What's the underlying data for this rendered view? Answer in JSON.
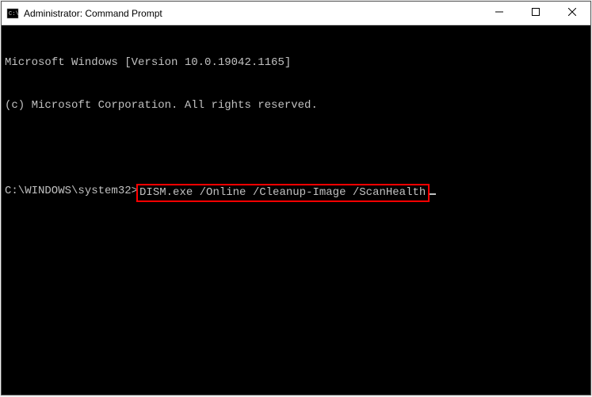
{
  "window": {
    "title": "Administrator: Command Prompt"
  },
  "terminal": {
    "header_line1": "Microsoft Windows [Version 10.0.19042.1165]",
    "header_line2": "(c) Microsoft Corporation. All rights reserved.",
    "prompt": "C:\\WINDOWS\\system32>",
    "command": "DISM.exe /Online /Cleanup-Image /ScanHealth"
  }
}
